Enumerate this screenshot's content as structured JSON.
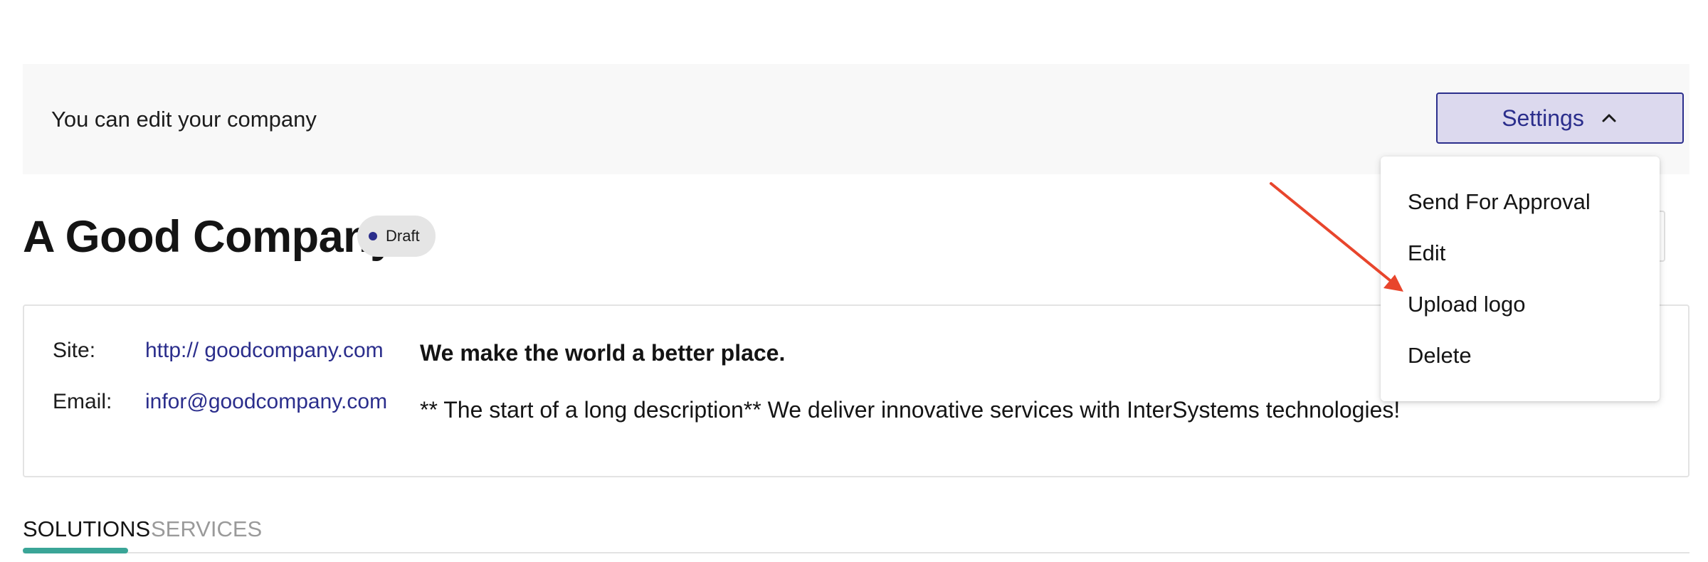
{
  "banner": {
    "message": "You can edit your company",
    "settings_label": "Settings",
    "settings_icon": "chevron-up-icon"
  },
  "company": {
    "name": "A Good Company",
    "status": "Draft",
    "status_color": "#2b2e8c"
  },
  "info": {
    "site_label": "Site:",
    "site_value": "http:// goodcompany.com",
    "email_label": "Email:",
    "email_value": "infor@goodcompany.com",
    "tagline": "We make the world a better place.",
    "description": "** The start of a long description** We deliver innovative services with InterSystems technologies!"
  },
  "tabs": [
    {
      "label": "SOLUTIONS",
      "active": true
    },
    {
      "label": "SERVICES",
      "active": false
    }
  ],
  "settings_menu": {
    "items": [
      {
        "label": "Send For Approval"
      },
      {
        "label": "Edit"
      },
      {
        "label": "Upload logo"
      },
      {
        "label": "Delete"
      }
    ]
  },
  "colors": {
    "accent": "#2b2e8c",
    "accent_bg": "#dcd9ee",
    "tab_indicator": "#3aa597",
    "annotation_arrow": "#e8452c"
  }
}
